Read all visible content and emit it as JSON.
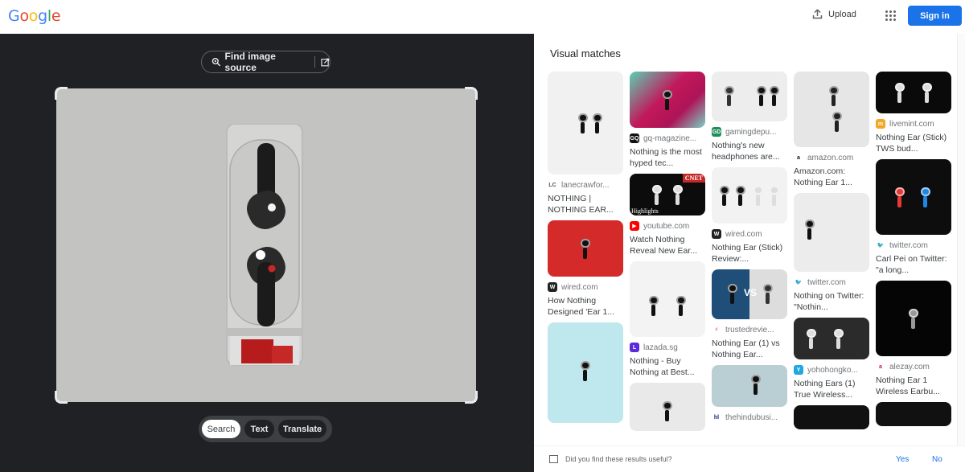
{
  "header": {
    "logo_letters": [
      {
        "ch": "G",
        "color": "#4285f4"
      },
      {
        "ch": "o",
        "color": "#ea4335"
      },
      {
        "ch": "o",
        "color": "#fbbc05"
      },
      {
        "ch": "g",
        "color": "#4285f4"
      },
      {
        "ch": "l",
        "color": "#34a853"
      },
      {
        "ch": "e",
        "color": "#ea4335"
      }
    ],
    "upload_label": "Upload",
    "apps_icon": "apps-grid-icon",
    "signin_label": "Sign in"
  },
  "lens": {
    "find_source_label": "Find image source",
    "modes": [
      {
        "label": "Search",
        "active": true
      },
      {
        "label": "Text",
        "active": false
      },
      {
        "label": "Translate",
        "active": false
      }
    ]
  },
  "results": {
    "heading": "Visual matches",
    "columns": [
      [
        {
          "source": "lanecrawfor...",
          "favicon": "LC",
          "fav_color": "#ffffff",
          "fav_text": "#555555",
          "title": "NOTHING | NOTHING EAR...",
          "thumb": "white-earbuds"
        },
        {
          "source": "wired.com",
          "favicon": "W",
          "fav_color": "#222222",
          "fav_text": "#ffffff",
          "title": "How Nothing Designed 'Ear 1...",
          "thumb": "red-earbud"
        },
        {
          "source": "",
          "favicon": "",
          "fav_color": "#cccccc",
          "fav_text": "#ffffff",
          "title": "",
          "thumb": "cyan-earbud"
        }
      ],
      [
        {
          "source": "gq-magazine...",
          "favicon": "GQ",
          "fav_color": "#111111",
          "fav_text": "#ffffff",
          "title": "Nothing is the most hyped tec...",
          "thumb": "pink-earbud"
        },
        {
          "source": "youtube.com",
          "favicon": "▶",
          "fav_color": "#ff0000",
          "fav_text": "#ffffff",
          "title": "Watch Nothing Reveal New Ear...",
          "thumb": "cnet-earbuds",
          "badge": "CNET",
          "overlay": "Highlights"
        },
        {
          "source": "lazada.sg",
          "favicon": "L",
          "fav_color": "#5b2bd9",
          "fav_text": "#ffffff",
          "title": "Nothing - Buy Nothing at Best...",
          "thumb": "lazada-earbuds"
        },
        {
          "source": "",
          "favicon": "",
          "fav_color": "#cccccc",
          "fav_text": "#ffffff",
          "title": "",
          "thumb": "closeup-earbud"
        }
      ],
      [
        {
          "source": "gamingdepu...",
          "favicon": "GD",
          "fav_color": "#1e8e5a",
          "fav_text": "#ffffff",
          "title": "Nothing's new headphones are...",
          "thumb": "case-and-buds"
        },
        {
          "source": "wired.com",
          "favicon": "W",
          "fav_color": "#222222",
          "fav_text": "#ffffff",
          "title": "Nothing Ear (Stick) Review:...",
          "thumb": "four-buds"
        },
        {
          "source": "trustedrevie...",
          "favicon": "⚡",
          "fav_color": "#ffffff",
          "fav_text": "#e53935",
          "title": "Nothing Ear (1) vs Nothing Ear...",
          "thumb": "vs-buds",
          "overlay": "VS"
        },
        {
          "source": "thehindubusi...",
          "favicon": "hl",
          "fav_color": "#ffffff",
          "fav_text": "#1a237e",
          "title": "",
          "thumb": "teal-case"
        }
      ],
      [
        {
          "source": "amazon.com",
          "favicon": "a",
          "fav_color": "#ffffff",
          "fav_text": "#111111",
          "title": "Amazon.com: Nothing Ear 1...",
          "thumb": "clear-case"
        },
        {
          "source": "twitter.com",
          "favicon": "🐦",
          "fav_color": "#ffffff",
          "fav_text": "#1da1f2",
          "title": "Nothing on Twitter: \"Nothin...",
          "thumb": "receipt"
        },
        {
          "source": "yohohongko...",
          "favicon": "Y",
          "fav_color": "#1ea7e1",
          "fav_text": "#ffffff",
          "title": "Nothing Ears (1) True Wireless...",
          "thumb": "yoho-buds"
        },
        {
          "source": "",
          "favicon": "",
          "fav_color": "#cccccc",
          "fav_text": "#ffffff",
          "title": "",
          "thumb": "dark-buds"
        }
      ],
      [
        {
          "source": "livemint.com",
          "favicon": "m",
          "fav_color": "#f5a623",
          "fav_text": "#ffffff",
          "title": "Nothing Ear (Stick) TWS bud...",
          "thumb": "black-buds"
        },
        {
          "source": "twitter.com",
          "favicon": "🐦",
          "fav_color": "#ffffff",
          "fav_text": "#1da1f2",
          "title": "Carl Pei on Twitter: \"a long...",
          "thumb": "glow-buds"
        },
        {
          "source": "alezay.com",
          "favicon": "a",
          "fav_color": "#ffffff",
          "fav_text": "#c2185b",
          "title": "Nothing Ear 1 Wireless Earbu...",
          "thumb": "dark-case"
        },
        {
          "source": "",
          "favicon": "",
          "fav_color": "#cccccc",
          "fav_text": "#ffffff",
          "title": "",
          "thumb": "red-dark-buds"
        }
      ]
    ]
  },
  "feedback": {
    "question": "Did you find these results useful?",
    "yes_label": "Yes",
    "no_label": "No"
  }
}
